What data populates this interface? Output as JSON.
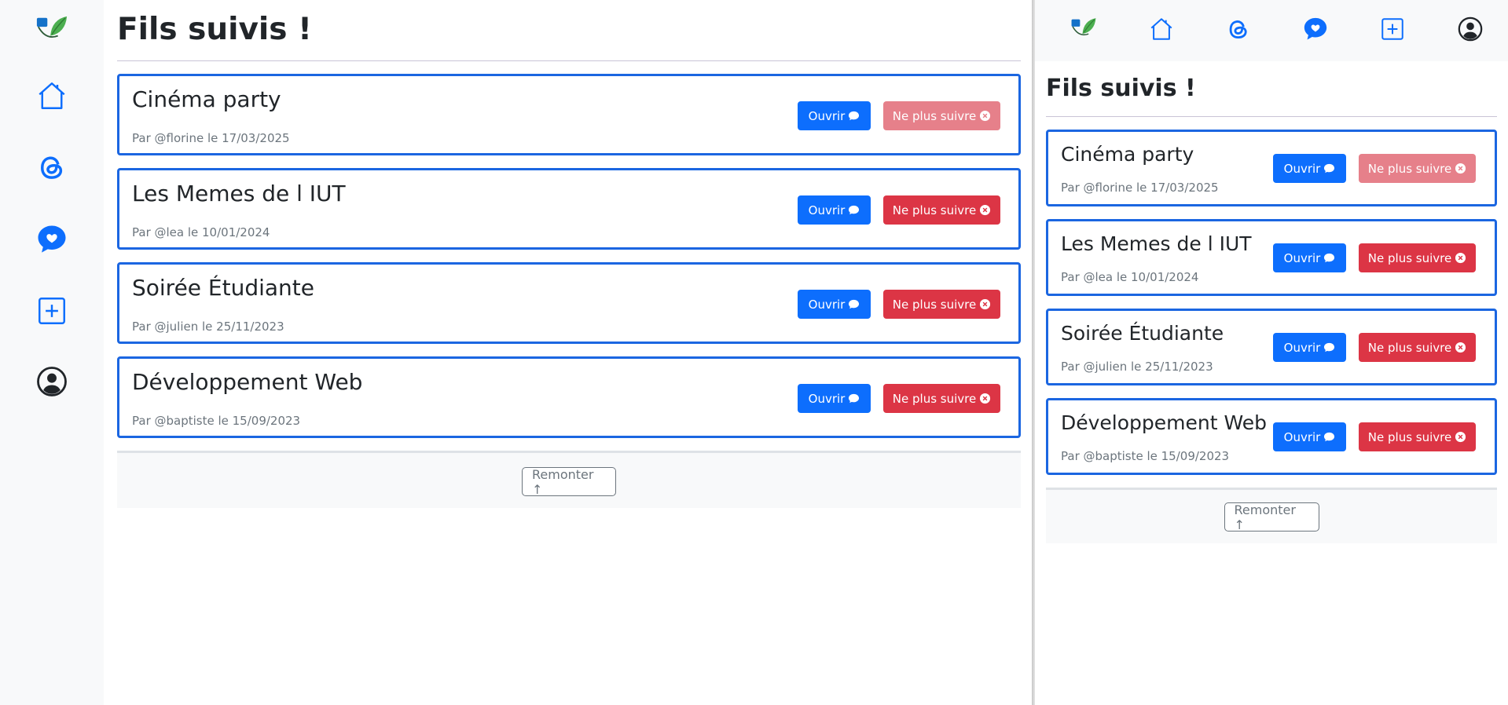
{
  "page": {
    "title": "Fils suivis !",
    "scroll_top_label": "Remonter ↑"
  },
  "colors": {
    "primary": "#0d6efd",
    "danger": "#dc3545",
    "danger_faded": "#e6808a",
    "card_border": "#1b66e1",
    "sidebar_bg": "#f8f9fa",
    "muted_text": "#6c757d"
  },
  "nav": {
    "items": [
      {
        "icon": "logo-icon"
      },
      {
        "icon": "home-icon"
      },
      {
        "icon": "threads-icon"
      },
      {
        "icon": "chat-heart-icon"
      },
      {
        "icon": "plus-square-icon"
      },
      {
        "icon": "user-circle-icon"
      }
    ]
  },
  "buttons": {
    "open_label": "Ouvrir",
    "unfollow_label": "Ne plus suivre"
  },
  "threads": [
    {
      "title": "Cinéma party",
      "meta": "Par @florine le 17/03/2025",
      "unfollow_faded": true
    },
    {
      "title": "Les Memes de l IUT",
      "meta": "Par @lea le 10/01/2024",
      "unfollow_faded": false
    },
    {
      "title": "Soirée Étudiante",
      "meta": "Par @julien le 25/11/2023",
      "unfollow_faded": false
    },
    {
      "title": "Développement Web",
      "meta": "Par @baptiste le 15/09/2023",
      "unfollow_faded": false
    }
  ]
}
